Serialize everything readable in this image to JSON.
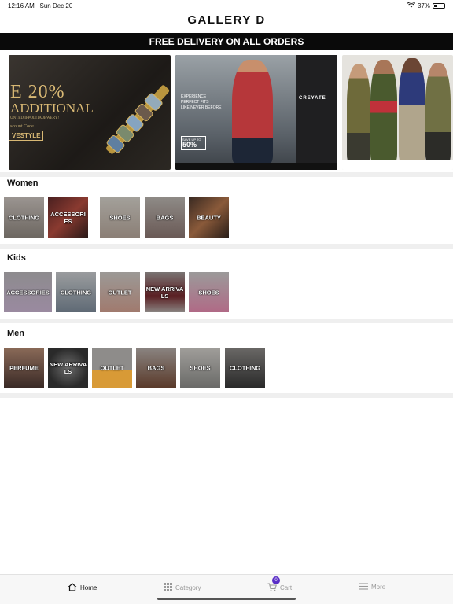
{
  "status": {
    "time": "12:16 AM",
    "date": "Sun Dec 20",
    "battery": "37%",
    "battery_level": 0.37
  },
  "brand": "GALLERY D",
  "promo": "FREE DELIVERY ON ALL ORDERS",
  "banners": [
    {
      "line1": "E 20%",
      "line2": "ADDITIONAL",
      "line3": "UNTED IPPOLITA JEWERY!",
      "code_label": "scount Code",
      "code": "VESTYLE"
    },
    {
      "line1": "EXPERIENCE",
      "line2": "PERFECT FITS",
      "line3": "LIKE NEVER BEFORE",
      "save_top": "SAVE UP TO",
      "save_value": "50%",
      "brand": "CREYATE"
    },
    {}
  ],
  "sections": {
    "women": {
      "title": "Women",
      "items": [
        "CLOTHING",
        "ACCESSORIES",
        "SHOES",
        "BAGS",
        "BEAUTY"
      ]
    },
    "kids": {
      "title": "Kids",
      "items": [
        "ACCESSORIES",
        "CLOTHING",
        "OUTLET",
        "NEW ARRIVALS",
        "SHOES"
      ]
    },
    "men": {
      "title": "Men",
      "items": [
        "PERFUME",
        "NEW ARRIVALS",
        "OUTLET",
        "BAGS",
        "SHOES",
        "CLOTHING"
      ]
    }
  },
  "tabs": {
    "home": "Home",
    "category": "Category",
    "cart": "Cart",
    "more": "More",
    "cart_count": "0"
  },
  "icons": [
    "wifi-icon",
    "battery-icon",
    "home-icon",
    "grid-icon",
    "cart-icon",
    "menu-icon"
  ]
}
